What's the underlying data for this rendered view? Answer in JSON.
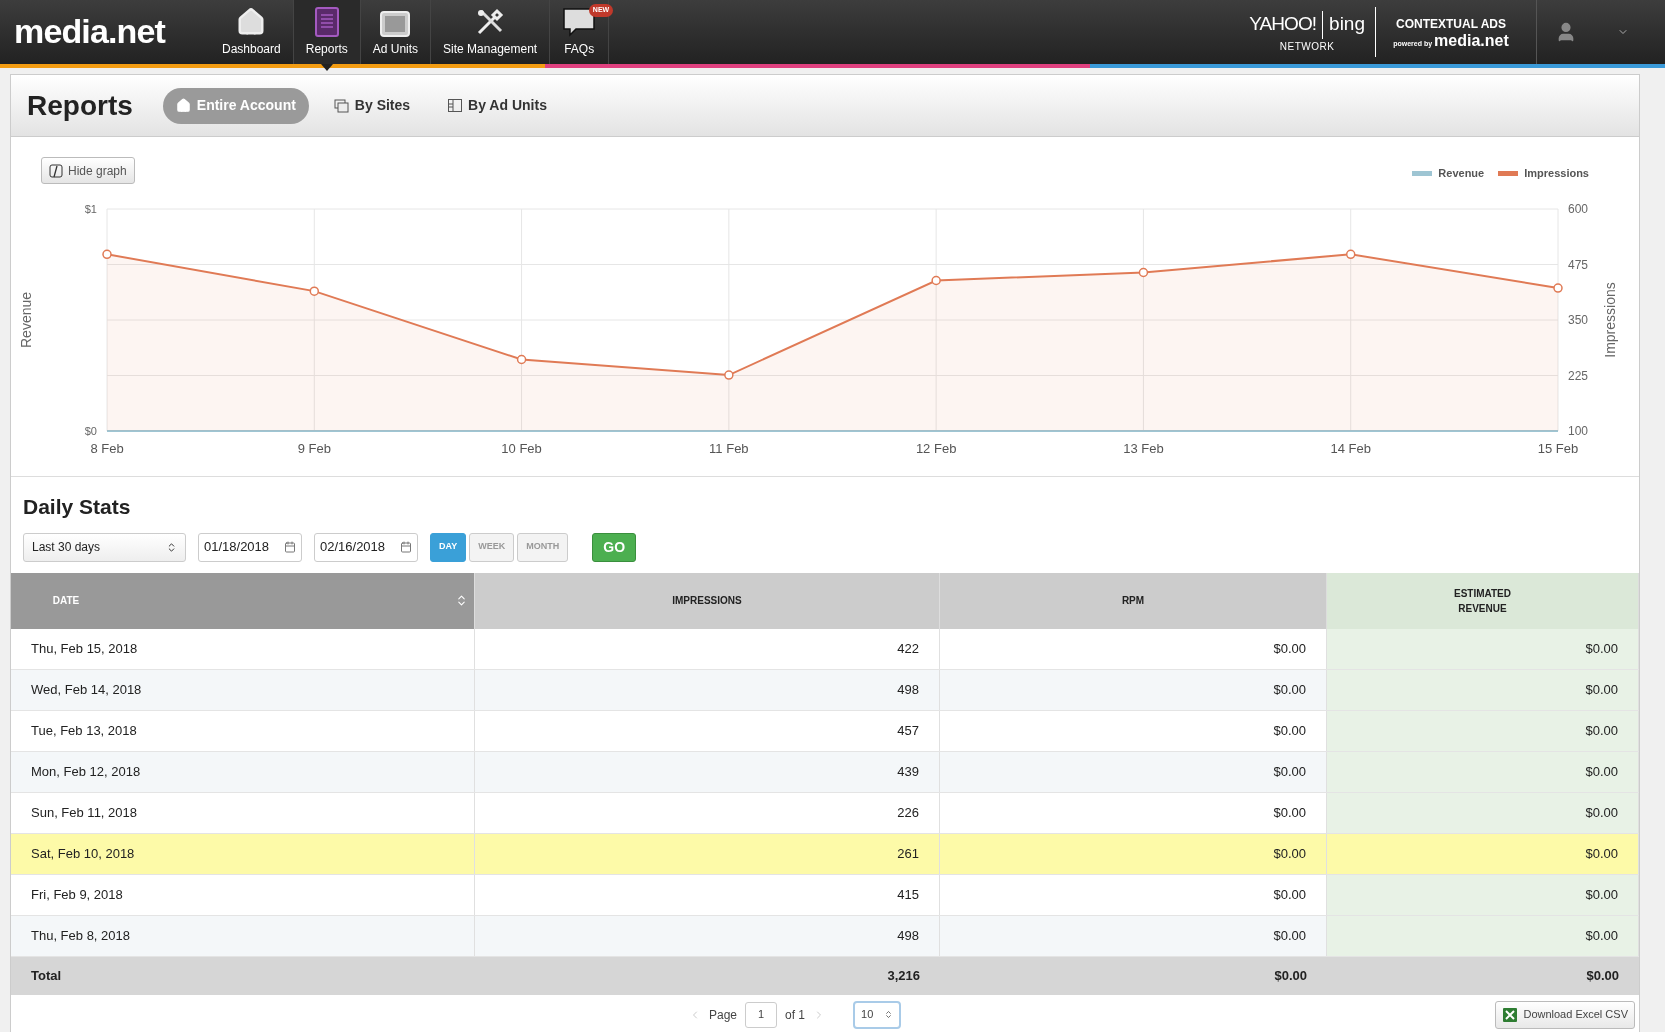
{
  "nav": {
    "logo": "media.net",
    "items": [
      {
        "label": "Dashboard",
        "selected": false
      },
      {
        "label": "Reports",
        "selected": true
      },
      {
        "label": "Ad Units",
        "selected": false
      },
      {
        "label": "Site Management",
        "selected": false
      },
      {
        "label": "FAQs",
        "selected": false,
        "badge": "NEW"
      }
    ],
    "partner": {
      "yahoo": "YAHOO!",
      "bing": "bing",
      "network": "NETWORK",
      "contextual": "CONTEXTUAL ADS",
      "powered": "powered by",
      "brand": "media.net"
    }
  },
  "header": {
    "title": "Reports",
    "tabs": [
      {
        "label": "Entire Account",
        "selected": true
      },
      {
        "label": "By Sites",
        "selected": false
      },
      {
        "label": "By Ad Units",
        "selected": false
      }
    ]
  },
  "graph": {
    "toggle": "Hide graph",
    "left_axis_title": "Revenue",
    "right_axis_title": "Impressions",
    "left_axis_ticks": [
      "$1",
      "$0"
    ],
    "chart_data": {
      "type": "area",
      "categories": [
        "8 Feb",
        "9 Feb",
        "10 Feb",
        "11 Feb",
        "12 Feb",
        "13 Feb",
        "14 Feb",
        "15 Feb"
      ],
      "series": [
        {
          "name": "Revenue",
          "color": "#9ec5d3",
          "values": [
            null,
            null,
            null,
            null,
            null,
            null,
            null,
            null
          ]
        },
        {
          "name": "Impressions",
          "color": "#e07a55",
          "values": [
            498,
            415,
            261,
            226,
            439,
            457,
            498,
            422
          ]
        }
      ],
      "ylim": [
        100,
        600
      ],
      "yticks": [
        100,
        225,
        350,
        475,
        600
      ],
      "grid": true
    }
  },
  "daily_stats": {
    "title": "Daily Stats",
    "range": "Last 30 days",
    "from": "01/18/2018",
    "to": "02/16/2018",
    "periods": [
      {
        "label": "DAY",
        "selected": true
      },
      {
        "label": "WEEK",
        "selected": false
      },
      {
        "label": "MONTH",
        "selected": false
      }
    ],
    "go": "GO",
    "columns": [
      {
        "label": "DATE",
        "sorted": true,
        "kind": "date"
      },
      {
        "label": "IMPRESSIONS",
        "sorted": false,
        "kind": "number"
      },
      {
        "label": "RPM",
        "sorted": false,
        "kind": "number"
      },
      {
        "label": "ESTIMATED REVENUE",
        "sorted": false,
        "kind": "revenue"
      }
    ],
    "rows": [
      {
        "cells": [
          "Thu, Feb 15, 2018",
          "422",
          "$0.00",
          "$0.00"
        ],
        "highlighted": false
      },
      {
        "cells": [
          "Wed, Feb 14, 2018",
          "498",
          "$0.00",
          "$0.00"
        ],
        "highlighted": false
      },
      {
        "cells": [
          "Tue, Feb 13, 2018",
          "457",
          "$0.00",
          "$0.00"
        ],
        "highlighted": false
      },
      {
        "cells": [
          "Mon, Feb 12, 2018",
          "439",
          "$0.00",
          "$0.00"
        ],
        "highlighted": false
      },
      {
        "cells": [
          "Sun, Feb 11, 2018",
          "226",
          "$0.00",
          "$0.00"
        ],
        "highlighted": false
      },
      {
        "cells": [
          "Sat, Feb 10, 2018",
          "261",
          "$0.00",
          "$0.00"
        ],
        "highlighted": true
      },
      {
        "cells": [
          "Fri, Feb 9, 2018",
          "415",
          "$0.00",
          "$0.00"
        ],
        "highlighted": false
      },
      {
        "cells": [
          "Thu, Feb 8, 2018",
          "498",
          "$0.00",
          "$0.00"
        ],
        "highlighted": false
      }
    ],
    "total": [
      "Total",
      "3,216",
      "$0.00",
      "$0.00"
    ],
    "pagination": {
      "page_label": "Page",
      "page": "1",
      "of": "of 1",
      "per_page": "10"
    },
    "download": "Download Excel CSV"
  }
}
